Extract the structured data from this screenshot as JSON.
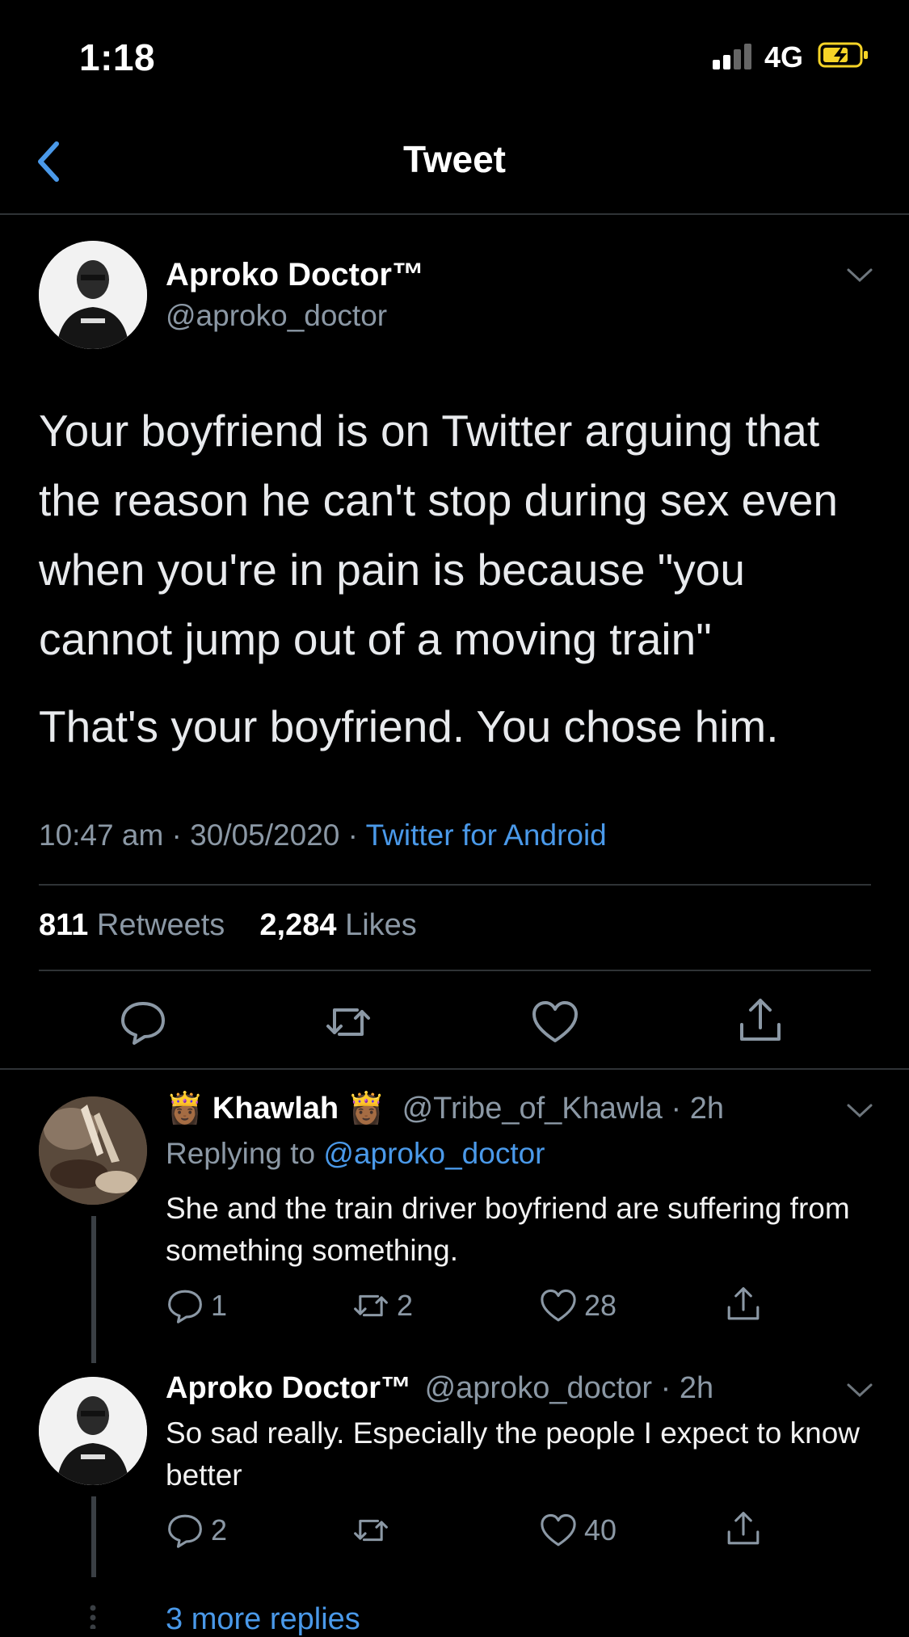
{
  "status_bar": {
    "time": "1:18",
    "network": "4G"
  },
  "header": {
    "title": "Tweet"
  },
  "tweet": {
    "name": "Aproko Doctor™",
    "handle": "@aproko_doctor",
    "paragraphs": [
      "Your boyfriend is on Twitter arguing that the reason he can't stop during sex even when you're in pain is because \"you cannot jump out of a moving train\"",
      "That's your boyfriend. You chose him."
    ],
    "time": "10:47 am",
    "date": "30/05/2020",
    "source": "Twitter for Android",
    "retweets": "811",
    "retweets_label": "Retweets",
    "likes": "2,284",
    "likes_label": "Likes"
  },
  "replies": [
    {
      "name_emoji_left": "👸🏾",
      "name": "Khawlah",
      "name_emoji_right": "👸🏾",
      "handle_time": "@Tribe_of_Khawla · 2h",
      "replying_prefix": "Replying to",
      "replying_to": "@aproko_doctor",
      "text": "She and the train driver boyfriend are suffering from something something.",
      "reply_count": "1",
      "retweet_count": "2",
      "like_count": "28"
    },
    {
      "name": "Aproko Doctor™",
      "handle_time": "@aproko_doctor · 2h",
      "text": "So sad really. Especially the people I expect to know better",
      "reply_count": "2",
      "retweet_count": "",
      "like_count": "40"
    }
  ],
  "more_replies": "3 more replies",
  "colors": {
    "background": "#000000",
    "accent": "#4a99e9",
    "muted": "#8b98a5",
    "divider": "#2f3336",
    "battery": "#f5d327"
  }
}
